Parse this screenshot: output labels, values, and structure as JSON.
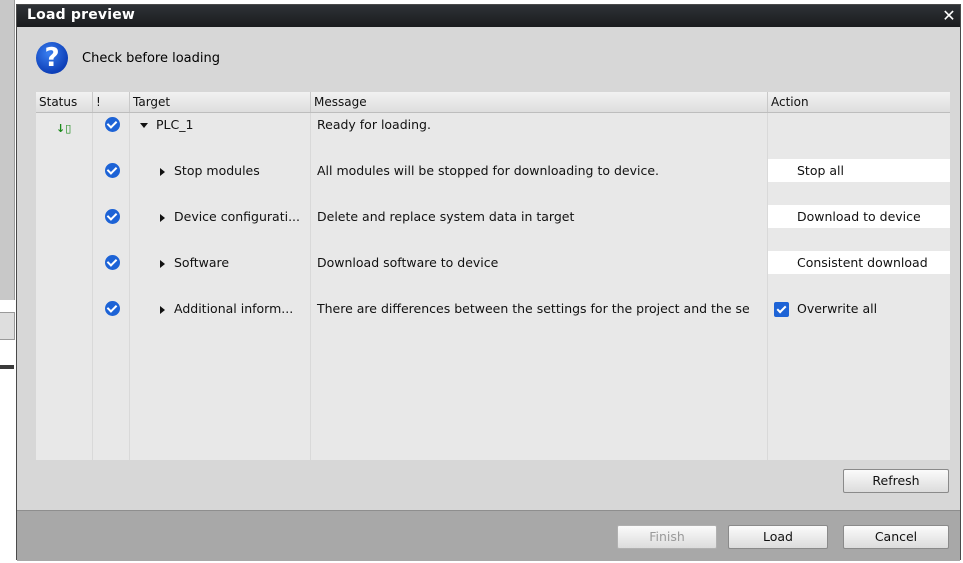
{
  "dialog": {
    "title": "Load preview",
    "close_glyph": "✕",
    "header_icon": "question-icon",
    "header_icon_glyph": "?",
    "header_text": "Check before loading"
  },
  "columns": {
    "status": "Status",
    "ex": "!",
    "target": "Target",
    "message": "Message",
    "action": "Action"
  },
  "rows": [
    {
      "status_icon": "download-arrow-icon",
      "status_glyph": "↓▯",
      "check": true,
      "expand": "down",
      "target": "PLC_1",
      "message": "Ready for loading.",
      "action": ""
    },
    {
      "check": true,
      "expand": "right",
      "target": "Stop modules",
      "message": "All modules will be stopped for downloading to device.",
      "action": "Stop all"
    },
    {
      "check": true,
      "expand": "right",
      "target": "Device configurati...",
      "message": "Delete and replace system data in target",
      "action": "Download to device"
    },
    {
      "check": true,
      "expand": "right",
      "target": "Software",
      "message": "Download software to device",
      "action": "Consistent download"
    },
    {
      "check": true,
      "expand": "right",
      "target": "Additional inform...",
      "message": "There are differences between the settings for the project and the se",
      "action": "Overwrite all",
      "action_checkbox": true
    }
  ],
  "buttons": {
    "refresh": "Refresh",
    "finish": "Finish",
    "load": "Load",
    "cancel": "Cancel"
  },
  "colors": {
    "titlebar": "#1f2225",
    "accent": "#1d63d6",
    "dialog_bg": "#d7d7d7",
    "footer_bg": "#a8a8a8"
  }
}
